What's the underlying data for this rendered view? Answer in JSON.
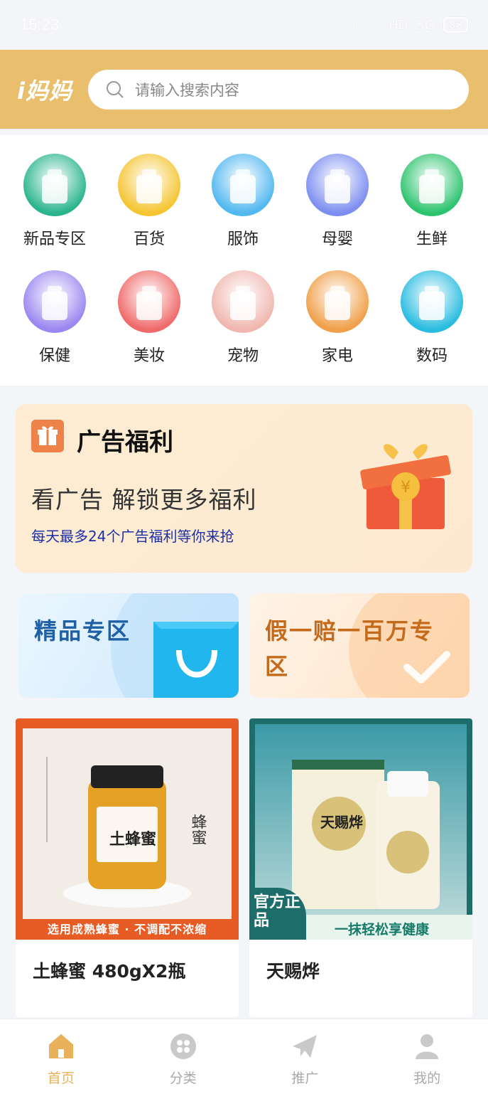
{
  "status_bar": {
    "time": "15:23",
    "network": "5G",
    "hd": "HD",
    "battery": "88"
  },
  "header": {
    "logo": "i妈妈",
    "search_placeholder": "请输入搜索内容"
  },
  "categories": [
    {
      "label": "新品专区",
      "icon": "juice-bottles-icon",
      "color": "#2bb58d"
    },
    {
      "label": "百货",
      "icon": "detergent-bottle-icon",
      "color": "#f5c533"
    },
    {
      "label": "服饰",
      "icon": "jacket-icon",
      "color": "#52b8f0"
    },
    {
      "label": "母婴",
      "icon": "baby-products-icon",
      "color": "#7d8ef0"
    },
    {
      "label": "生鲜",
      "icon": "fresh-produce-icon",
      "color": "#2ec46f"
    },
    {
      "label": "保健",
      "icon": "supplements-icon",
      "color": "#9b87f0"
    },
    {
      "label": "美妆",
      "icon": "cosmetics-icon",
      "color": "#f06a6a"
    },
    {
      "label": "宠物",
      "icon": "pet-cat-icon",
      "color": "#f0b7b0"
    },
    {
      "label": "家电",
      "icon": "appliances-icon",
      "color": "#f0a04a"
    },
    {
      "label": "数码",
      "icon": "electronics-icon",
      "color": "#2abce0"
    }
  ],
  "ad": {
    "title": "广告福利",
    "main_text": "看广告  解锁更多福利",
    "sub_text": "每天最多24个广告福利等你来抢"
  },
  "promos": {
    "left_title": "精品专区",
    "right_title": "假一赔一百万专区"
  },
  "products": [
    {
      "name": "土蜂蜜 480gX2瓶",
      "banner": "选用成熟蜂蜜 · 不调配不浓缩",
      "jar_label": "土蜂蜜",
      "side_text": "蜂蜜"
    },
    {
      "name": "天赐烨",
      "badge": "官方正品",
      "slogan": "一抹轻松享健康",
      "box_label": "天赐烨"
    }
  ],
  "tabbar": [
    {
      "label": "首页",
      "icon": "home-icon",
      "active": true
    },
    {
      "label": "分类",
      "icon": "category-icon",
      "active": false
    },
    {
      "label": "推广",
      "icon": "paper-plane-icon",
      "active": false
    },
    {
      "label": "我的",
      "icon": "user-icon",
      "active": false
    }
  ],
  "colors": {
    "header": "#e9bf6e",
    "accent": "#e9b15b",
    "ad_icon": "#ef8248"
  }
}
